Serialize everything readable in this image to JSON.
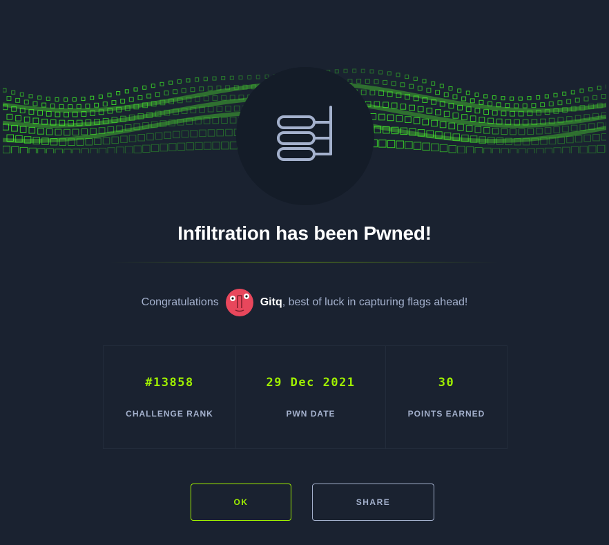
{
  "modal": {
    "title": "Infiltration has been Pwned!",
    "congrats_prefix": "Congratulations",
    "username": "Gitq",
    "congrats_suffix": ", best of luck in capturing flags ahead!",
    "badge_icon": "database-tree-icon"
  },
  "stats": [
    {
      "value": "#13858",
      "label": "CHALLENGE RANK"
    },
    {
      "value": "29 Dec 2021",
      "label": "PWN DATE"
    },
    {
      "value": "30",
      "label": "POINTS EARNED"
    }
  ],
  "buttons": {
    "ok_label": "OK",
    "share_label": "SHARE"
  },
  "colors": {
    "background": "#1a2230",
    "accent_green": "#9fef00",
    "muted_text": "#a4b1cd",
    "avatar_pink": "#e8475c"
  }
}
